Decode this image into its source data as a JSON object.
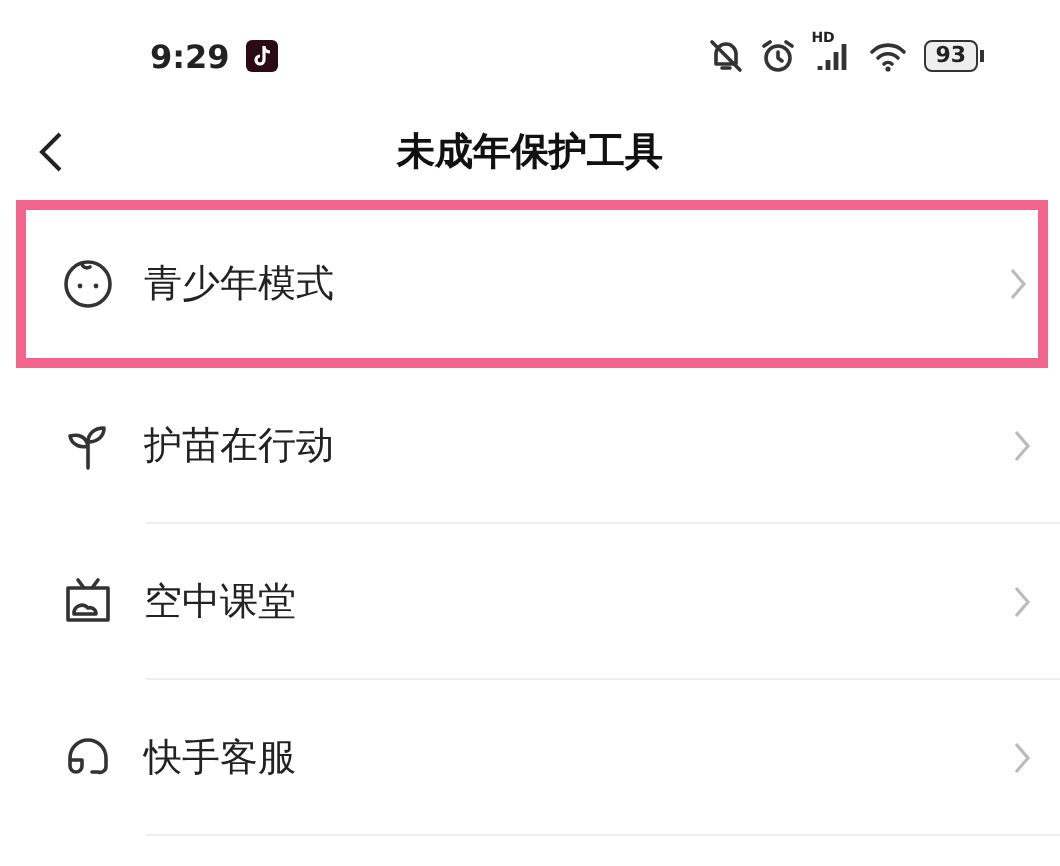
{
  "status_bar": {
    "time": "9:29",
    "network_label": "HD",
    "battery": "93"
  },
  "header": {
    "title": "未成年保护工具"
  },
  "items": [
    {
      "label": "青少年模式",
      "kind": "face",
      "highlighted": true
    },
    {
      "label": "护苗在行动",
      "kind": "sprout",
      "highlighted": false
    },
    {
      "label": "空中课堂",
      "kind": "tv",
      "highlighted": false
    },
    {
      "label": "快手客服",
      "kind": "headset",
      "highlighted": false
    }
  ]
}
